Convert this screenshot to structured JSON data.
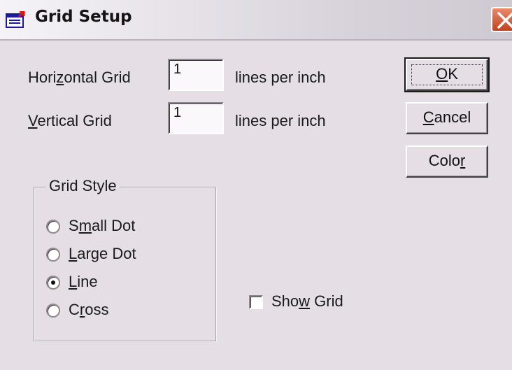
{
  "window": {
    "title": "Grid Setup",
    "icon": "grid-setup-app-icon",
    "close_icon": "close-icon"
  },
  "horizontal": {
    "label_pre": "Hori",
    "label_key": "z",
    "label_post": "ontal Grid",
    "value": "1",
    "unit": "lines per inch"
  },
  "vertical": {
    "label_key": "V",
    "label_post": "ertical Grid",
    "value": "1",
    "unit": "lines per inch"
  },
  "buttons": {
    "ok_key": "O",
    "ok_post": "K",
    "cancel_key": "C",
    "cancel_post": "ancel",
    "color_pre": "Colo",
    "color_key": "r"
  },
  "grid_style": {
    "title": "Grid Style",
    "selected": "Line",
    "options": [
      {
        "pre": "S",
        "key": "m",
        "post": "all Dot"
      },
      {
        "pre": "",
        "key": "L",
        "post": "arge Dot"
      },
      {
        "pre": "",
        "key": "L",
        "post": "ine"
      },
      {
        "pre": "C",
        "key": "r",
        "post": "oss"
      }
    ]
  },
  "show_grid": {
    "pre": "Sho",
    "key": "w",
    "post": " Grid",
    "checked": false
  }
}
